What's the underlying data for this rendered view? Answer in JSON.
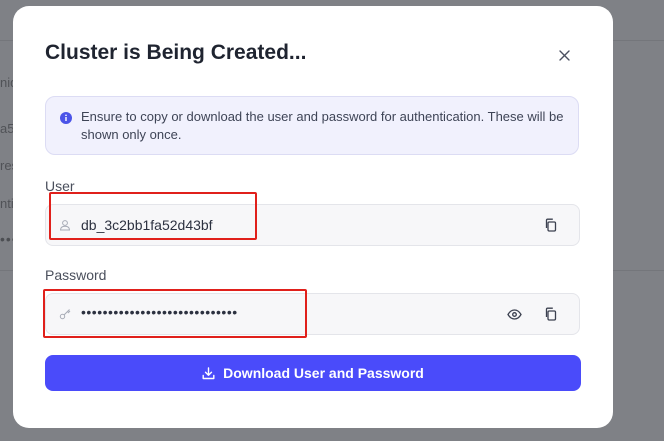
{
  "background": {
    "fragments": [
      "nid",
      "a5",
      "res",
      "ntia"
    ],
    "dots": "••••"
  },
  "modal": {
    "title": "Cluster is Being Created...",
    "close_icon": "close-icon",
    "info": {
      "icon": "info-icon",
      "text": "Ensure to copy or download the user and password for authentication. These will be shown only once."
    },
    "user": {
      "label": "User",
      "value": "db_3c2bb1fa52d43bf",
      "icon": "user-icon",
      "copy_icon": "copy-icon"
    },
    "password": {
      "label": "Password",
      "value": "•••••••••••••••••••••••••••••",
      "icon": "key-icon",
      "reveal_icon": "eye-icon",
      "copy_icon": "copy-icon"
    },
    "download_button": {
      "label": "Download User and Password",
      "icon": "download-icon"
    }
  },
  "colors": {
    "accent": "#4a4bfa",
    "highlight": "#e0201b",
    "info_bg": "#f1f1fd"
  }
}
